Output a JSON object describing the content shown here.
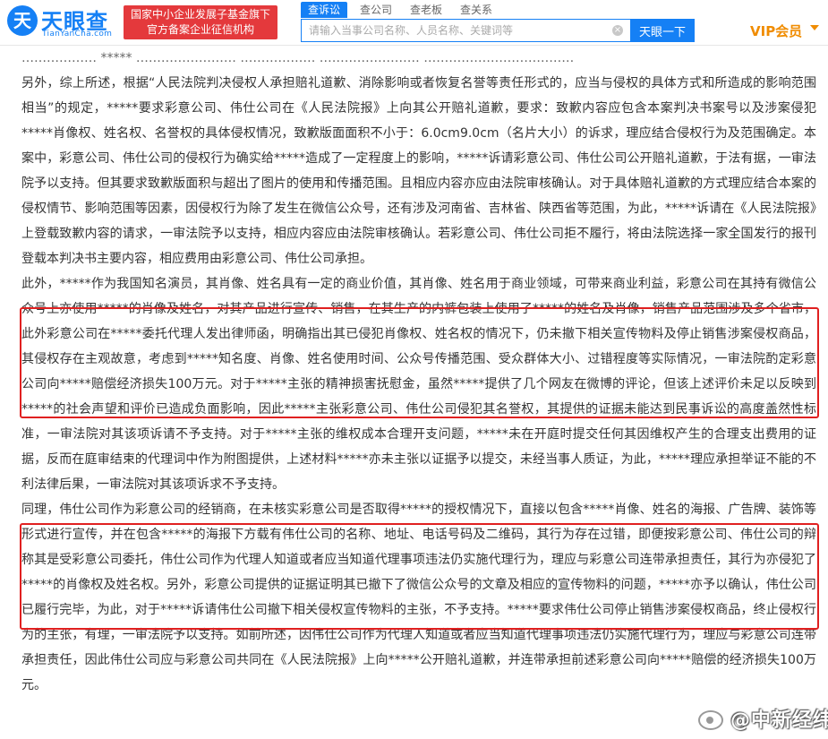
{
  "header": {
    "logo_icon": "天",
    "logo_name": "天眼查",
    "logo_domain": "TianYanCha.com",
    "slogan_line1": "国家中小企业发展子基金旗下",
    "slogan_line2": "官方备案企业征信机构",
    "tabs": [
      "查诉讼",
      "查公司",
      "查老板",
      "查关系"
    ],
    "search_placeholder": "请输入当事公司名称、人员名称、关键词等",
    "search_value": "",
    "clear_icon": "×",
    "search_button": "天眼一下",
    "vip_label": "VIP会员",
    "accent_color": "#1580f5",
    "slogan_color": "#e4393c",
    "vip_color": "#f08c00"
  },
  "document": {
    "peek_line": "……………… ***** …………………… ……………… …………………… ………………………………",
    "paragraphs": [
      "另外，综上所述，根据“人民法院判决侵权人承担赔礼道歉、消除影响或者恢复名誉等责任形式的，应当与侵权的具体方式和所造成的影响范围相当”的规定，*****要求彩意公司、伟仕公司在《人民法院报》上向其公开赔礼道歉，要求：致歉内容应包含本案判决书案号以及涉案侵犯*****肖像权、姓名权、名誉权的具体侵权情况，致歉版面面积不小于：6.0cm9.0cm（名片大小）的诉求，理应结合侵权行为及范围确定。本案中，彩意公司、伟仕公司的侵权行为确实给*****造成了一定程度上的影响，*****诉请彩意公司、伟仕公司公开赔礼道歉，于法有据，一审法院予以支持。但其要求致歉版面积与超出了图片的使用和传播范围。且相应内容亦应由法院审核确认。对于具体赔礼道歉的方式理应结合本案的侵权情节、影响范围等因素，因侵权行为除了发生在微信公众号，还有涉及河南省、吉林省、陕西省等范围，为此，*****诉请在《人民法院报》上登载致歉内容的请求，一审法院予以支持，相应内容应由法院审核确认。若彩意公司、伟仕公司拒不履行，将由法院选择一家全国发行的报刊登载本判决书主要内容，相应费用由彩意公司、伟仕公司承担。",
      "此外，*****作为我国知名演员，其肖像、姓名具有一定的商业价值，其肖像、姓名用于商业领域，可带来商业利益，彩意公司在其持有微信公众号上亦使用*****的肖像及姓名，对其产品进行宣传、销售，在其生产的内裤包装上使用了*****的姓名及肖像，销售产品范围涉及多个省市，此外彩意公司在*****委托代理人发出律师函，明确指出其已侵犯肖像权、姓名权的情况下，仍未撤下相关宣传物料及停止销售涉案侵权商品，其侵权存在主观故意，考虑到*****知名度、肖像、姓名使用时间、公众号传播范围、受众群体大小、过错程度等实际情况，一审法院酌定彩意公司向*****赔偿经济损失100万元。对于*****主张的精神损害抚慰金，虽然*****提供了几个网友在微博的评论，但该上述评价未足以反映到*****的社会声望和评价已造成负面影响，因此*****主张彩意公司、伟仕公司侵犯其名誉权，其提供的证据未能达到民事诉讼的高度盖然性标准，一审法院对其该项诉请不予支持。对于*****主张的维权成本合理开支问题，*****未在开庭时提交任何其因维权产生的合理支出费用的证据，反而在庭审结束的代理词中作为附图提供，上述材料*****亦未主张以证据予以提交，未经当事人质证，为此，*****理应承担举证不能的不利法律后果，一审法院对其该项诉求不予支持。",
      "同理，伟仕公司作为彩意公司的经销商，在未核实彩意公司是否取得*****的授权情况下，直接以包含*****肖像、姓名的海报、广告牌、装饰等形式进行宣传，并在包含*****的海报下方载有伟仕公司的名称、地址、电话号码及二维码，其行为存在过错，即便按彩意公司、伟仕公司的辩称其是受彩意公司委托，伟仕公司作为代理人知道或者应当知道代理事项违法仍实施代理行为，理应与彩意公司连带承担责任，其行为亦侵犯了*****的肖像权及姓名权。另外，彩意公司提供的证据证明其已撤下了微信公众号的文章及相应的宣传物料的问题，*****亦予以确认，伟仕公司已履行完毕，为此，对于*****诉请伟仕公司撤下相关侵权宣传物料的主张，不予支持。*****要求伟仕公司停止销售涉案侵权商品，终止侵权行为的主张，有理，一审法院予以支持。如前所述，因伟仕公司作为代理人知道或者应当知道代理事项违法仍实施代理行为，理应与彩意公司连带承担责任，因此伟仕公司应与彩意公司共同在《人民法院报》上向*****公开赔礼道歉，并连带承担前述彩意公司向*****赔偿的经济损失100万元。"
    ],
    "highlight_color": "#e02020"
  },
  "watermark": {
    "icon": "weibo-icon",
    "text": "@中新经纬"
  }
}
